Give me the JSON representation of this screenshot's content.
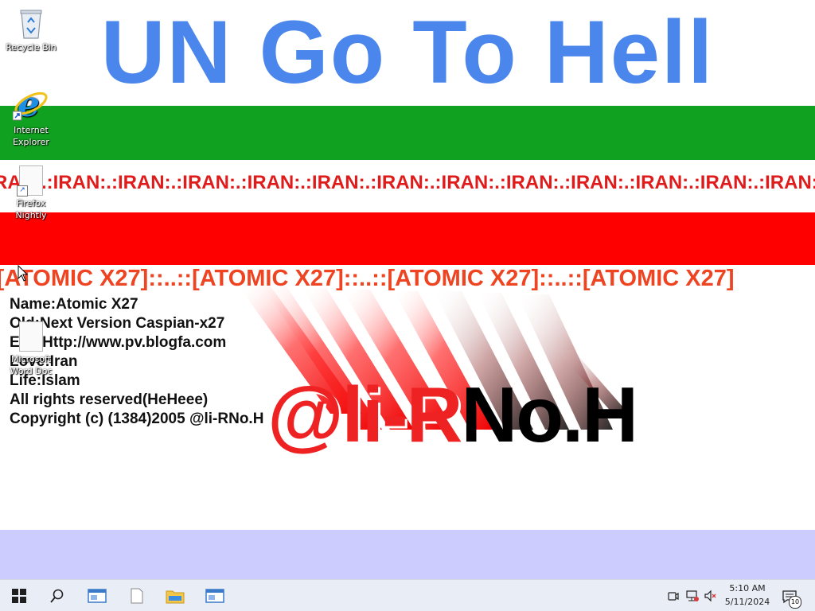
{
  "banner": {
    "title": "UN Go To Hell",
    "iran_marquee": ":RAN:.:IRAN:.:IRAN:.:IRAN:.:IRAN:.:IRAN:.:IRAN:.:IRAN:.:IRAN:.:IRAN:.:IRAN:.:IRAN:.:IRAN:.:IR",
    "atomic_marquee": ":[ATOMIC X27]::..::[ATOMIC X27]::..::[ATOMIC X27]::..::[ATOMIC X27]",
    "info_lines": [
      "Name:Atomic X27",
      "Old:Next Version Caspian-x27",
      "E-M:Http://www.pv.blogfa.com",
      "Love:Iran",
      "Life:Islam",
      "All rights reserved(HeHeee)",
      "Copyright (c) (1384)2005 @li-RNo.H"
    ],
    "logo_red": "@li-R",
    "logo_black": "No.H"
  },
  "desktop_icons": [
    {
      "label": "Recycle Bin",
      "icon": "recycle-bin-icon"
    },
    {
      "label": "Internet Explorer",
      "icon": "internet-explorer-icon"
    },
    {
      "label": "Firefox Nightly",
      "icon": "document-icon"
    },
    {
      "label": "Microsoft Word Doc",
      "icon": "document-icon"
    }
  ],
  "taskbar": {
    "start": "windows-start-icon",
    "search": "search-icon",
    "apps": [
      "window-app-icon",
      "document-app-icon",
      "file-explorer-icon",
      "window-app-icon"
    ],
    "time": "5:10 AM",
    "date": "5/11/2024",
    "notifications": "10"
  },
  "colors": {
    "title_blue": "#4a86ec",
    "green": "#11a121",
    "red": "#ff0000",
    "lavender": "#ccccff"
  }
}
